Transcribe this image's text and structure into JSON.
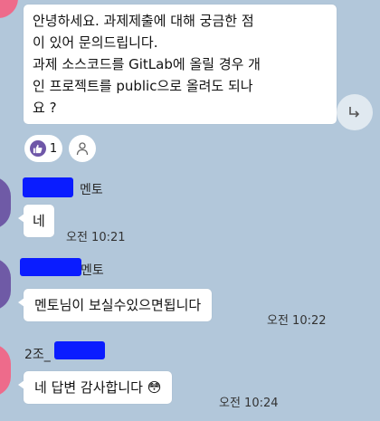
{
  "chat": {
    "colors": {
      "background": "#b2c7da",
      "bubble": "#ffffff",
      "redaction": "#0a1cff",
      "avatar_pink": "#ee6b8b",
      "avatar_purple": "#6f5aa6",
      "like_badge": "#6f57a8"
    },
    "messages": {
      "question": {
        "lines": [
          "안녕하세요. 과제제출에 대해 궁금한 점",
          "이 있어 문의드립니다.",
          "과제 소스코드를 GitLab에 올릴 경우 개",
          "인 프로젝트를 public으로 올려도 되나",
          "요 ?"
        ],
        "share_icon": "share-arrow-icon",
        "reactions": {
          "like_count": "1",
          "like_icon": "thumbs-up-icon",
          "add_icon": "person-icon"
        }
      },
      "mentor_reply_1": {
        "sender_suffix": "멘토",
        "text": "네",
        "time": "오전 10:21"
      },
      "mentor_reply_2": {
        "sender_suffix": "멘토",
        "text": "멘토님이 보실수있으면됩니다",
        "time": "오전 10:22"
      },
      "team_reply": {
        "sender_prefix": "2조_",
        "text": "네 답변 감사합니다 😳",
        "time": "오전 10:24"
      }
    }
  }
}
